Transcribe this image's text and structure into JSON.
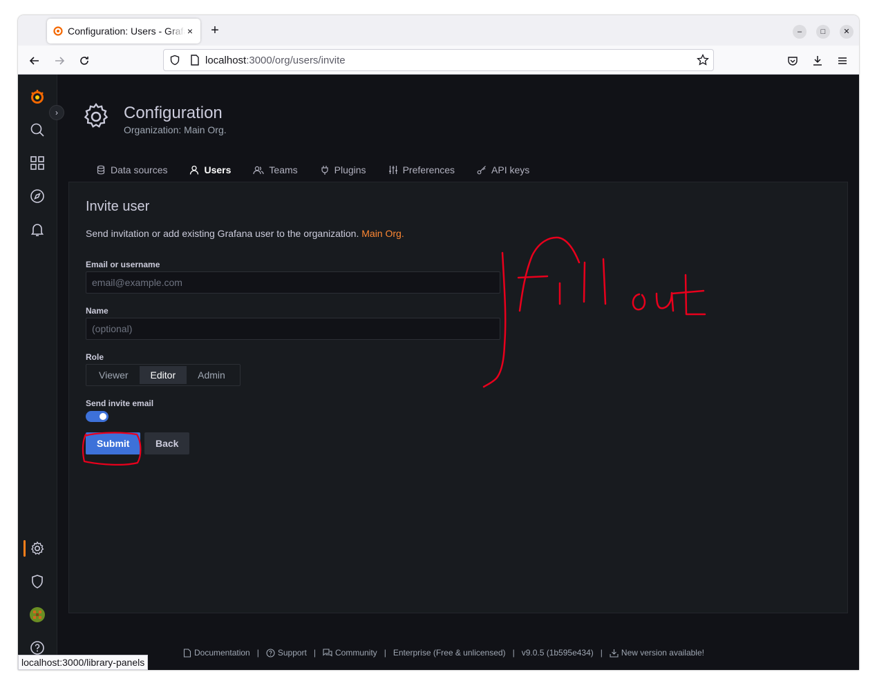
{
  "browser": {
    "tab_title": "Configuration: Users - Grafana",
    "close_tab": "×",
    "new_tab": "+",
    "url_host": "localhost",
    "url_path": ":3000/org/users/invite",
    "status_link": "localhost:3000/library-panels"
  },
  "header": {
    "title": "Configuration",
    "subtitle": "Organization: Main Org."
  },
  "tabs": [
    {
      "label": "Data sources",
      "icon": "database-icon"
    },
    {
      "label": "Users",
      "icon": "user-icon"
    },
    {
      "label": "Teams",
      "icon": "users-icon"
    },
    {
      "label": "Plugins",
      "icon": "plug-icon"
    },
    {
      "label": "Preferences",
      "icon": "sliders-icon"
    },
    {
      "label": "API keys",
      "icon": "key-icon"
    }
  ],
  "form": {
    "heading": "Invite user",
    "description": "Send invitation or add existing Grafana user to the organization.",
    "org_name": "Main Org.",
    "email_label": "Email or username",
    "email_placeholder": "email@example.com",
    "name_label": "Name",
    "name_placeholder": "(optional)",
    "role_label": "Role",
    "roles": [
      "Viewer",
      "Editor",
      "Admin"
    ],
    "selected_role": "Editor",
    "send_email_label": "Send invite email",
    "send_email_on": true,
    "submit_label": "Submit",
    "back_label": "Back"
  },
  "footer": {
    "documentation": "Documentation",
    "support": "Support",
    "community": "Community",
    "edition": "Enterprise (Free & unlicensed)",
    "version": "v9.0.5 (1b595e434)",
    "update": "New version available!",
    "separator": "|"
  },
  "annotation": {
    "text": "fill out",
    "color": "#e8001c"
  },
  "colors": {
    "accent": "#ff8833",
    "primary_button": "#3d71d9",
    "background": "#111217",
    "panel": "#181b1f"
  }
}
